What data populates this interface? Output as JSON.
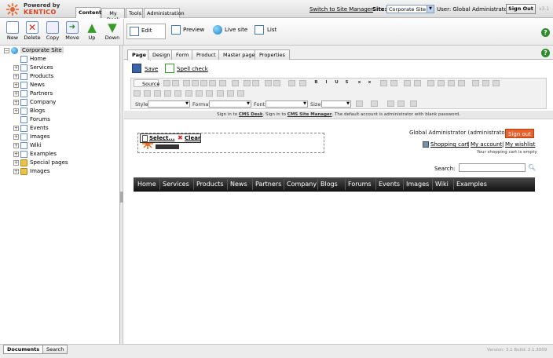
{
  "header": {
    "logo_powered": "Powered by",
    "logo_brand": "KENTICO",
    "tabs": [
      "Content",
      "My Desk",
      "Tools",
      "Administration"
    ],
    "switch_link": "Switch to Site Manager",
    "site_label": "Site:",
    "site_value": "Corporate Site",
    "user_label": "User: Global Administrator",
    "signout": "Sign Out",
    "version": "v3.1"
  },
  "toolbar": {
    "buttons": [
      "New",
      "Delete",
      "Copy",
      "Move",
      "Up",
      "Down"
    ],
    "view_buttons": [
      "Edit",
      "Preview",
      "Live site",
      "List"
    ]
  },
  "tree": {
    "root": "Corporate Site",
    "items": [
      "Home",
      "Services",
      "Products",
      "News",
      "Partners",
      "Company",
      "Blogs",
      "Forums",
      "Events",
      "Images",
      "Wiki",
      "Examples",
      "Special pages",
      "Images"
    ]
  },
  "bottom": {
    "tabs": [
      "Documents",
      "Search"
    ],
    "version_info": "Version: 3.1 Build: 3.1.3009"
  },
  "editor": {
    "tabs": [
      "Page",
      "Design",
      "Form",
      "Product",
      "Master page",
      "Properties"
    ],
    "save": "Save",
    "spellcheck": "Spell check",
    "source": "Source",
    "style_label": "Style",
    "format_label": "Format",
    "font_label": "Font",
    "size_label": "Size"
  },
  "preview": {
    "signin_text_1": "Sign in to ",
    "signin_link_1": "CMS Desk",
    "signin_text_2": ". Sign in to ",
    "signin_link_2": "CMS Site Manager",
    "signin_text_3": ". The default account is administrator with blank password.",
    "select_label": "Select...",
    "clear_label": "Clear",
    "cms_text": "CMS",
    "user_text": "Global Administrator (administrator)",
    "signout": "Sign out",
    "shopping_cart": "Shopping cart",
    "my_account": "My account",
    "my_wishlist": "My wishlist",
    "cart_empty": "Your shopping cart is empty",
    "search_label": "Search:",
    "menu": [
      "Home",
      "Services",
      "Products",
      "News",
      "Partners",
      "Company",
      "Blogs",
      "Forums",
      "Events",
      "Images",
      "Wiki",
      "Examples"
    ]
  },
  "colors": {
    "accent_orange": "#e8612c",
    "menu_bg": "#1a1a1a",
    "help_green": "#2e8b2e"
  }
}
